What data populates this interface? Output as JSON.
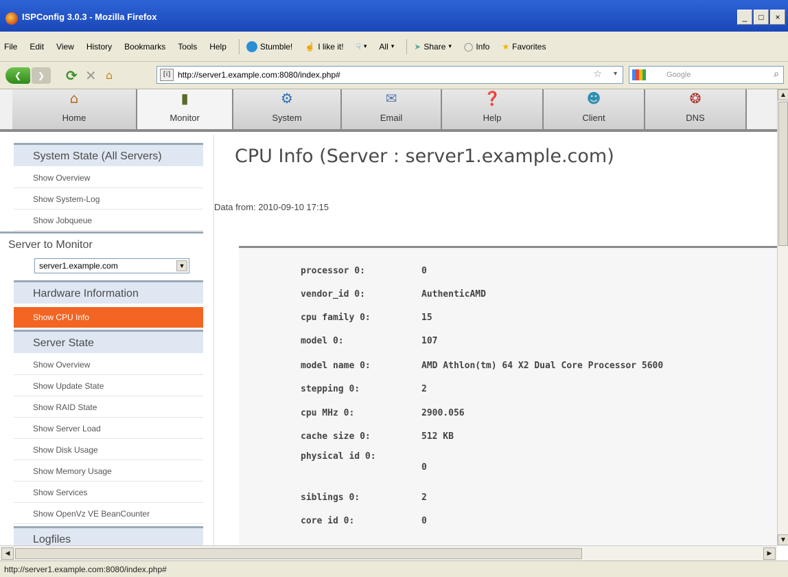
{
  "window": {
    "title": "ISPConfig 3.0.3 - Mozilla Firefox",
    "controls": [
      "_",
      "□",
      "×"
    ]
  },
  "menubar": {
    "items": [
      "File",
      "Edit",
      "View",
      "History",
      "Bookmarks",
      "Tools",
      "Help"
    ],
    "toolbar": [
      "Stumble!",
      "I like it!",
      "All",
      "Share",
      "Info",
      "Favorites"
    ]
  },
  "navbar": {
    "url": "http://server1.example.com:8080/index.php#",
    "search_placeholder": "Google"
  },
  "apptabs": [
    "Home",
    "Monitor",
    "System",
    "Email",
    "Help",
    "Client",
    "DNS"
  ],
  "sidebar": {
    "section1": "System State (All Servers)",
    "section1_items": [
      "Show Overview",
      "Show System-Log",
      "Show Jobqueue"
    ],
    "server_label": "Server to Monitor",
    "server_select": "server1.example.com",
    "section2": "Hardware Information",
    "section2_items": [
      "Show CPU Info"
    ],
    "section3": "Server State",
    "section3_items": [
      "Show Overview",
      "Show Update State",
      "Show RAID State",
      "Show Server Load",
      "Show Disk Usage",
      "Show Memory Usage",
      "Show Services",
      "Show OpenVz VE BeanCounter"
    ],
    "section4": "Logfiles"
  },
  "main": {
    "title": "CPU Info (Server : server1.example.com)",
    "data_from": "Data from: 2010-09-10 17:15",
    "rows": [
      {
        "k": "processor 0:",
        "v": "0"
      },
      {
        "k": "vendor_id 0:",
        "v": "AuthenticAMD"
      },
      {
        "k": "cpu family 0:",
        "v": "15"
      },
      {
        "k": "model 0:",
        "v": "107"
      },
      {
        "k": "model name 0:",
        "v": "AMD Athlon(tm) 64 X2 Dual Core Processor 5600"
      },
      {
        "k": "stepping 0:",
        "v": "2"
      },
      {
        "k": "cpu MHz 0:",
        "v": "2900.056"
      },
      {
        "k": "cache size 0:",
        "v": "512 KB"
      },
      {
        "k": "physical id 0:",
        "v": "0"
      },
      {
        "k": "siblings 0:",
        "v": "2"
      },
      {
        "k": "core id 0:",
        "v": "0"
      }
    ]
  },
  "statusbar": {
    "text": "http://server1.example.com:8080/index.php#"
  }
}
